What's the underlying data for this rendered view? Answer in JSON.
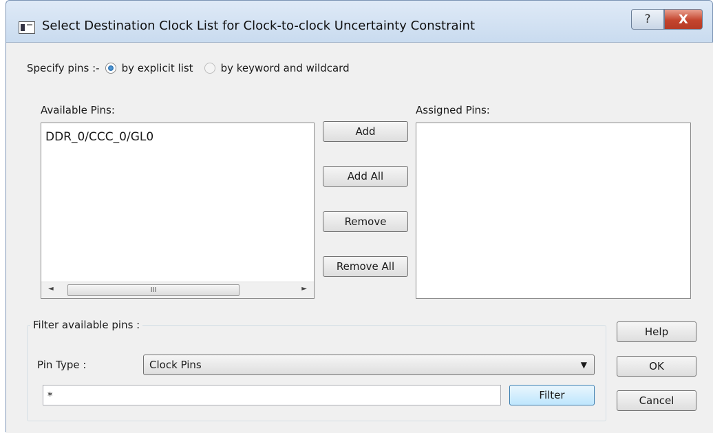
{
  "window": {
    "title": "Select Destination Clock List for Clock-to-clock Uncertainty Constraint",
    "help_glyph": "?",
    "close_glyph": "X"
  },
  "specify": {
    "label": "Specify pins :-",
    "option_explicit": "by explicit list",
    "option_keyword": "by keyword and wildcard",
    "selected": "by explicit list"
  },
  "available": {
    "label": "Available Pins:",
    "items": [
      "DDR_0/CCC_0/GL0"
    ],
    "scroll_left": "◄",
    "scroll_right": "►",
    "scroll_grip": "III"
  },
  "assigned": {
    "label": "Assigned Pins:",
    "items": []
  },
  "buttons": {
    "add": "Add",
    "add_all": "Add All",
    "remove": "Remove",
    "remove_all": "Remove All",
    "help": "Help",
    "ok": "OK",
    "cancel": "Cancel",
    "filter": "Filter"
  },
  "filter": {
    "caption": "Filter available pins :",
    "pin_type_label": "Pin Type :",
    "pin_type_value": "Clock Pins",
    "pattern_value": "*"
  },
  "icons": {
    "dropdown": "▼",
    "window": "dialog-window-icon"
  }
}
